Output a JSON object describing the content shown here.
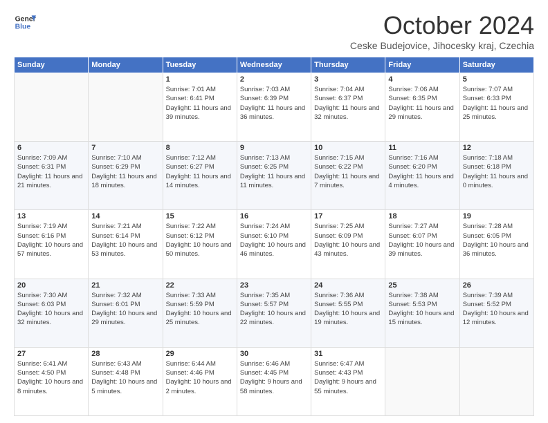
{
  "header": {
    "logo_line1": "General",
    "logo_line2": "Blue",
    "month": "October 2024",
    "location": "Ceske Budejovice, Jihocesky kraj, Czechia"
  },
  "weekdays": [
    "Sunday",
    "Monday",
    "Tuesday",
    "Wednesday",
    "Thursday",
    "Friday",
    "Saturday"
  ],
  "weeks": [
    [
      {
        "day": "",
        "info": ""
      },
      {
        "day": "",
        "info": ""
      },
      {
        "day": "1",
        "info": "Sunrise: 7:01 AM\nSunset: 6:41 PM\nDaylight: 11 hours and 39 minutes."
      },
      {
        "day": "2",
        "info": "Sunrise: 7:03 AM\nSunset: 6:39 PM\nDaylight: 11 hours and 36 minutes."
      },
      {
        "day": "3",
        "info": "Sunrise: 7:04 AM\nSunset: 6:37 PM\nDaylight: 11 hours and 32 minutes."
      },
      {
        "day": "4",
        "info": "Sunrise: 7:06 AM\nSunset: 6:35 PM\nDaylight: 11 hours and 29 minutes."
      },
      {
        "day": "5",
        "info": "Sunrise: 7:07 AM\nSunset: 6:33 PM\nDaylight: 11 hours and 25 minutes."
      }
    ],
    [
      {
        "day": "6",
        "info": "Sunrise: 7:09 AM\nSunset: 6:31 PM\nDaylight: 11 hours and 21 minutes."
      },
      {
        "day": "7",
        "info": "Sunrise: 7:10 AM\nSunset: 6:29 PM\nDaylight: 11 hours and 18 minutes."
      },
      {
        "day": "8",
        "info": "Sunrise: 7:12 AM\nSunset: 6:27 PM\nDaylight: 11 hours and 14 minutes."
      },
      {
        "day": "9",
        "info": "Sunrise: 7:13 AM\nSunset: 6:25 PM\nDaylight: 11 hours and 11 minutes."
      },
      {
        "day": "10",
        "info": "Sunrise: 7:15 AM\nSunset: 6:22 PM\nDaylight: 11 hours and 7 minutes."
      },
      {
        "day": "11",
        "info": "Sunrise: 7:16 AM\nSunset: 6:20 PM\nDaylight: 11 hours and 4 minutes."
      },
      {
        "day": "12",
        "info": "Sunrise: 7:18 AM\nSunset: 6:18 PM\nDaylight: 11 hours and 0 minutes."
      }
    ],
    [
      {
        "day": "13",
        "info": "Sunrise: 7:19 AM\nSunset: 6:16 PM\nDaylight: 10 hours and 57 minutes."
      },
      {
        "day": "14",
        "info": "Sunrise: 7:21 AM\nSunset: 6:14 PM\nDaylight: 10 hours and 53 minutes."
      },
      {
        "day": "15",
        "info": "Sunrise: 7:22 AM\nSunset: 6:12 PM\nDaylight: 10 hours and 50 minutes."
      },
      {
        "day": "16",
        "info": "Sunrise: 7:24 AM\nSunset: 6:10 PM\nDaylight: 10 hours and 46 minutes."
      },
      {
        "day": "17",
        "info": "Sunrise: 7:25 AM\nSunset: 6:09 PM\nDaylight: 10 hours and 43 minutes."
      },
      {
        "day": "18",
        "info": "Sunrise: 7:27 AM\nSunset: 6:07 PM\nDaylight: 10 hours and 39 minutes."
      },
      {
        "day": "19",
        "info": "Sunrise: 7:28 AM\nSunset: 6:05 PM\nDaylight: 10 hours and 36 minutes."
      }
    ],
    [
      {
        "day": "20",
        "info": "Sunrise: 7:30 AM\nSunset: 6:03 PM\nDaylight: 10 hours and 32 minutes."
      },
      {
        "day": "21",
        "info": "Sunrise: 7:32 AM\nSunset: 6:01 PM\nDaylight: 10 hours and 29 minutes."
      },
      {
        "day": "22",
        "info": "Sunrise: 7:33 AM\nSunset: 5:59 PM\nDaylight: 10 hours and 25 minutes."
      },
      {
        "day": "23",
        "info": "Sunrise: 7:35 AM\nSunset: 5:57 PM\nDaylight: 10 hours and 22 minutes."
      },
      {
        "day": "24",
        "info": "Sunrise: 7:36 AM\nSunset: 5:55 PM\nDaylight: 10 hours and 19 minutes."
      },
      {
        "day": "25",
        "info": "Sunrise: 7:38 AM\nSunset: 5:53 PM\nDaylight: 10 hours and 15 minutes."
      },
      {
        "day": "26",
        "info": "Sunrise: 7:39 AM\nSunset: 5:52 PM\nDaylight: 10 hours and 12 minutes."
      }
    ],
    [
      {
        "day": "27",
        "info": "Sunrise: 6:41 AM\nSunset: 4:50 PM\nDaylight: 10 hours and 8 minutes."
      },
      {
        "day": "28",
        "info": "Sunrise: 6:43 AM\nSunset: 4:48 PM\nDaylight: 10 hours and 5 minutes."
      },
      {
        "day": "29",
        "info": "Sunrise: 6:44 AM\nSunset: 4:46 PM\nDaylight: 10 hours and 2 minutes."
      },
      {
        "day": "30",
        "info": "Sunrise: 6:46 AM\nSunset: 4:45 PM\nDaylight: 9 hours and 58 minutes."
      },
      {
        "day": "31",
        "info": "Sunrise: 6:47 AM\nSunset: 4:43 PM\nDaylight: 9 hours and 55 minutes."
      },
      {
        "day": "",
        "info": ""
      },
      {
        "day": "",
        "info": ""
      }
    ]
  ]
}
